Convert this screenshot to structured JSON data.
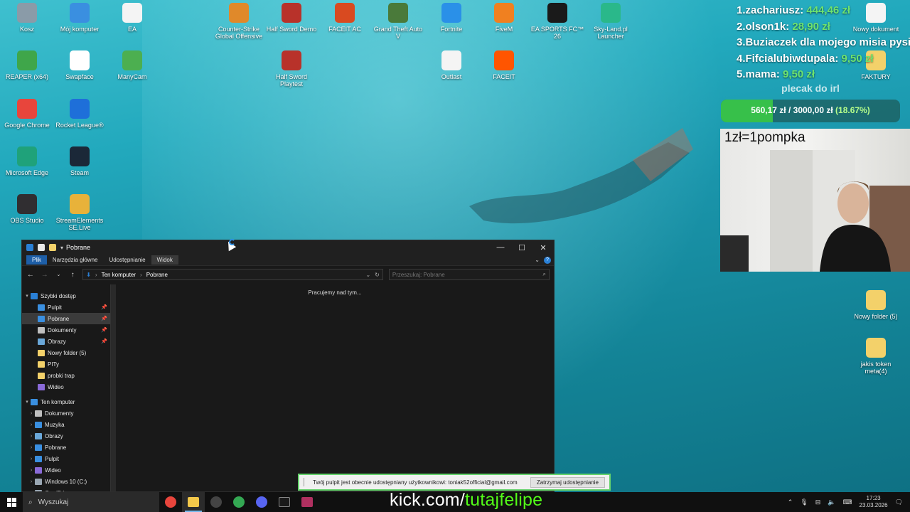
{
  "desktop": {
    "icons": [
      {
        "label": "Kosz",
        "icon": "recycle-bin-icon",
        "color": "#8a9ba8"
      },
      {
        "label": "Mój komputer",
        "icon": "computer-icon",
        "color": "#3a8fe0"
      },
      {
        "label": "EA",
        "icon": "file-icon",
        "color": "#f4f4f4"
      },
      {
        "label": "Counter-Strike Global Offensive",
        "icon": "csgo-icon",
        "color": "#e0892a"
      },
      {
        "label": "Half Sword Demo",
        "icon": "half-sword-icon",
        "color": "#b8322a"
      },
      {
        "label": "FACEIT AC",
        "icon": "faceit-ac-icon",
        "color": "#d94a20"
      },
      {
        "label": "Grand Theft Auto V",
        "icon": "gta-icon",
        "color": "#4a7a3a"
      },
      {
        "label": "Fortnite",
        "icon": "fortnite-icon",
        "color": "#2a90e8"
      },
      {
        "label": "FiveM",
        "icon": "fivem-icon",
        "color": "#f08020"
      },
      {
        "label": "EA SPORTS FC™ 26",
        "icon": "ea-fc-icon",
        "color": "#1a1a1a"
      },
      {
        "label": "Sky-Land.pl Launcher",
        "icon": "skyland-icon",
        "color": "#2ab88a"
      },
      {
        "label": "REAPER (x64)",
        "icon": "reaper-icon",
        "color": "#3fa64a"
      },
      {
        "label": "Swapface",
        "icon": "swapface-icon",
        "color": "#ffffff"
      },
      {
        "label": "ManyCam",
        "icon": "manycam-icon",
        "color": "#4caf50"
      },
      {
        "label": "Half Sword Playtest",
        "icon": "half-sword-playtest-icon",
        "color": "#b8322a"
      },
      {
        "label": "Outlast",
        "icon": "file-icon",
        "color": "#f4f4f4"
      },
      {
        "label": "FACEIT",
        "icon": "faceit-icon",
        "color": "#ff5500"
      },
      {
        "label": "Google Chrome",
        "icon": "chrome-icon",
        "color": "#e8453c"
      },
      {
        "label": "Rocket League®",
        "icon": "rocket-league-icon",
        "color": "#1e6fd9"
      },
      {
        "label": "Microsoft Edge",
        "icon": "edge-icon",
        "color": "#1fa27a"
      },
      {
        "label": "Steam",
        "icon": "steam-icon",
        "color": "#1b2838"
      },
      {
        "label": "OBS Studio",
        "icon": "obs-icon",
        "color": "#302e31"
      },
      {
        "label": "StreamElements SE.Live",
        "icon": "streamelements-icon",
        "color": "#e8b23a"
      },
      {
        "label": "Nowy dokument",
        "icon": "document-icon",
        "color": "#f4f4f4"
      },
      {
        "label": "FAKTURY",
        "icon": "folder-icon",
        "color": "#f3d16a"
      },
      {
        "label": "Nowy folder (5)",
        "icon": "folder-icon",
        "color": "#f3d16a"
      },
      {
        "label": "jakis token meta(4)",
        "icon": "folder-icon",
        "color": "#f3d16a"
      }
    ]
  },
  "overlay": {
    "leaderboard": [
      {
        "rank": "1.",
        "name": "zachariusz:",
        "amount": "444,46 zł"
      },
      {
        "rank": "2.",
        "name": "olson1k:",
        "amount": "28,90 zł"
      },
      {
        "rank": "3.",
        "name": "Buziaczek dla mojego misia pysia",
        "amount": ""
      },
      {
        "rank": "4.",
        "name": "Fifcialubiwdupala:",
        "amount": "9,50 zł"
      },
      {
        "rank": "5.",
        "name": "mama:",
        "amount": "9,50 zł"
      }
    ],
    "goal": {
      "title": "plecak do irl",
      "progress_text": "560,17 zł / 3000,00 zł",
      "percent_text": "(18.67%)",
      "progress": 0.1867
    },
    "cam_caption": "1zł=1pompka"
  },
  "explorer": {
    "title": "Pobrane",
    "ribbon_tabs": [
      "Plik",
      "Narzędzia główne",
      "Udostępnianie",
      "Widok"
    ],
    "breadcrumb": [
      "Ten komputer",
      "Pobrane"
    ],
    "search_placeholder": "Przeszukaj: Pobrane",
    "status_text": "Pracujemy nad tym...",
    "quick_access_label": "Szybki dostęp",
    "quick_access": [
      {
        "label": "Pulpit",
        "color": "#3a8fe0",
        "pinned": true,
        "selected": false
      },
      {
        "label": "Pobrane",
        "color": "#3a8fe0",
        "pinned": true,
        "selected": true
      },
      {
        "label": "Dokumenty",
        "color": "#bfbfbf",
        "pinned": true,
        "selected": false
      },
      {
        "label": "Obrazy",
        "color": "#6aa7d8",
        "pinned": true,
        "selected": false
      },
      {
        "label": "Nowy folder (5)",
        "color": "#f3d16a",
        "pinned": false,
        "selected": false
      },
      {
        "label": "PITy",
        "color": "#f3d16a",
        "pinned": false,
        "selected": false
      },
      {
        "label": "probki trap",
        "color": "#f3d16a",
        "pinned": false,
        "selected": false
      },
      {
        "label": "Wideo",
        "color": "#8a6ad8",
        "pinned": false,
        "selected": false
      }
    ],
    "this_pc_label": "Ten komputer",
    "this_pc": [
      {
        "label": "Dokumenty",
        "color": "#bfbfbf"
      },
      {
        "label": "Muzyka",
        "color": "#3a8fe0"
      },
      {
        "label": "Obrazy",
        "color": "#6aa7d8"
      },
      {
        "label": "Pobrane",
        "color": "#3a8fe0"
      },
      {
        "label": "Pulpit",
        "color": "#3a8fe0"
      },
      {
        "label": "Wideo",
        "color": "#8a6ad8"
      },
      {
        "label": "Windows 10 (C:)",
        "color": "#9aa7b3"
      },
      {
        "label": "Gry (D:)",
        "color": "#9aa7b3"
      }
    ]
  },
  "share_bar": {
    "message": "Twój pulpit jest obecnie udostępniany użytkownikowi: toniak52official@gmail.com",
    "stop_button": "Zatrzymaj udostępnianie"
  },
  "taskbar": {
    "search_label": "Wyszukaj",
    "apps": [
      {
        "name": "chrome",
        "color": "#e8453c",
        "active": false
      },
      {
        "name": "file-explorer",
        "color": "#f3c84a",
        "active": true
      },
      {
        "name": "obs",
        "color": "#444444",
        "active": false
      },
      {
        "name": "google-chrome-alt",
        "color": "#34a853",
        "active": false
      },
      {
        "name": "discord",
        "color": "#5865f2",
        "active": false
      },
      {
        "name": "terminal",
        "color": "#1a1a1a",
        "active": false
      },
      {
        "name": "winrar",
        "color": "#b03060",
        "active": false
      }
    ],
    "time": "17:23",
    "date": "23.03.2026"
  },
  "kick": {
    "prefix": "kick.com/",
    "handle": "tutajfelipe"
  }
}
